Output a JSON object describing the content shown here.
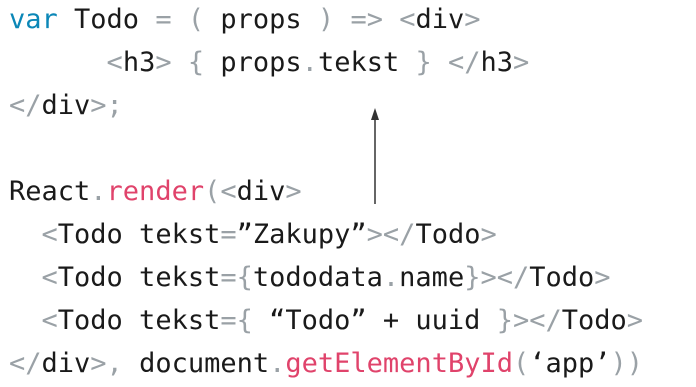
{
  "code_lines": [
    {
      "name": "line-todo-declaration",
      "tokens": [
        {
          "text": "var",
          "kind": "keyword"
        },
        {
          "text": " Todo ",
          "kind": "text"
        },
        {
          "text": "=",
          "kind": "punct"
        },
        {
          "text": " ",
          "kind": "text"
        },
        {
          "text": "(",
          "kind": "punct"
        },
        {
          "text": " props ",
          "kind": "text"
        },
        {
          "text": ")",
          "kind": "punct"
        },
        {
          "text": " ",
          "kind": "text"
        },
        {
          "text": "=>",
          "kind": "punct"
        },
        {
          "text": " ",
          "kind": "text"
        },
        {
          "text": "<",
          "kind": "punct"
        },
        {
          "text": "div",
          "kind": "text"
        },
        {
          "text": ">",
          "kind": "punct"
        }
      ]
    },
    {
      "name": "line-h3-props-tekst",
      "tokens": [
        {
          "text": "      ",
          "kind": "text"
        },
        {
          "text": "<",
          "kind": "punct"
        },
        {
          "text": "h3",
          "kind": "text"
        },
        {
          "text": ">",
          "kind": "punct"
        },
        {
          "text": " ",
          "kind": "text"
        },
        {
          "text": "{",
          "kind": "punct"
        },
        {
          "text": " props",
          "kind": "text"
        },
        {
          "text": ".",
          "kind": "punct"
        },
        {
          "text": "tekst ",
          "kind": "text"
        },
        {
          "text": "}",
          "kind": "punct"
        },
        {
          "text": " ",
          "kind": "text"
        },
        {
          "text": "</",
          "kind": "punct"
        },
        {
          "text": "h3",
          "kind": "text"
        },
        {
          "text": ">",
          "kind": "punct"
        }
      ]
    },
    {
      "name": "line-close-div",
      "tokens": [
        {
          "text": "</",
          "kind": "punct"
        },
        {
          "text": "div",
          "kind": "text"
        },
        {
          "text": ">;",
          "kind": "punct"
        }
      ]
    },
    {
      "name": "line-blank",
      "tokens": []
    },
    {
      "name": "line-react-render",
      "tokens": [
        {
          "text": "React",
          "kind": "text"
        },
        {
          "text": ".",
          "kind": "punct"
        },
        {
          "text": "render",
          "kind": "func"
        },
        {
          "text": "(<",
          "kind": "punct"
        },
        {
          "text": "div",
          "kind": "text"
        },
        {
          "text": ">",
          "kind": "punct"
        }
      ]
    },
    {
      "name": "line-todo-zakupy",
      "tokens": [
        {
          "text": "  ",
          "kind": "text"
        },
        {
          "text": "<",
          "kind": "punct"
        },
        {
          "text": "Todo tekst",
          "kind": "text"
        },
        {
          "text": "=",
          "kind": "punct"
        },
        {
          "text": "”Zakupy”",
          "kind": "text"
        },
        {
          "text": "></",
          "kind": "punct"
        },
        {
          "text": "Todo",
          "kind": "text"
        },
        {
          "text": ">",
          "kind": "punct"
        }
      ]
    },
    {
      "name": "line-todo-tododata-name",
      "tokens": [
        {
          "text": "  ",
          "kind": "text"
        },
        {
          "text": "<",
          "kind": "punct"
        },
        {
          "text": "Todo tekst",
          "kind": "text"
        },
        {
          "text": "={",
          "kind": "punct"
        },
        {
          "text": "tododata",
          "kind": "text"
        },
        {
          "text": ".",
          "kind": "punct"
        },
        {
          "text": "name",
          "kind": "text"
        },
        {
          "text": "}></",
          "kind": "punct"
        },
        {
          "text": "Todo",
          "kind": "text"
        },
        {
          "text": ">",
          "kind": "punct"
        }
      ]
    },
    {
      "name": "line-todo-uuid",
      "tokens": [
        {
          "text": "  ",
          "kind": "text"
        },
        {
          "text": "<",
          "kind": "punct"
        },
        {
          "text": "Todo tekst",
          "kind": "text"
        },
        {
          "text": "={",
          "kind": "punct"
        },
        {
          "text": " “Todo” + uuid ",
          "kind": "text"
        },
        {
          "text": "}></",
          "kind": "punct"
        },
        {
          "text": "Todo",
          "kind": "text"
        },
        {
          "text": ">",
          "kind": "punct"
        }
      ]
    },
    {
      "name": "line-render-target",
      "tokens": [
        {
          "text": "</",
          "kind": "punct"
        },
        {
          "text": "div",
          "kind": "text"
        },
        {
          "text": ">,",
          "kind": "punct"
        },
        {
          "text": " document",
          "kind": "text"
        },
        {
          "text": ".",
          "kind": "punct"
        },
        {
          "text": "getElementById",
          "kind": "func"
        },
        {
          "text": "(",
          "kind": "punct"
        },
        {
          "text": "‘app’",
          "kind": "text"
        },
        {
          "text": "))",
          "kind": "punct"
        }
      ]
    }
  ],
  "annotation": {
    "arrow_icon": "up-arrow-icon",
    "arrow_color": "#333333"
  },
  "colors": {
    "keyword": "#0b87b7",
    "function": "#e0436b",
    "punctuation": "#9aa1a6",
    "text": "#1a1a1a"
  }
}
